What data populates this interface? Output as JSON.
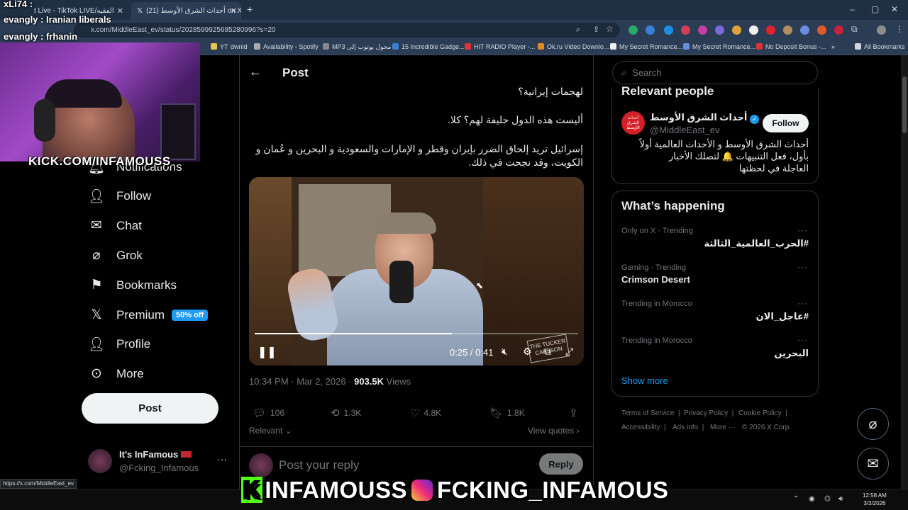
{
  "browser": {
    "tabs": [
      {
        "title": "t Live - TikTok LIVE/الفقيه"
      },
      {
        "title": "(21) أحداث الشرق الأوسط on X"
      }
    ],
    "new_tab": "+",
    "url": "x.com/MiddleEast_ev/status/2028599925685280996?s=20",
    "window_controls": [
      "–",
      "▢",
      "✕"
    ],
    "bookmarks": [
      "YT",
      "dwnld",
      "Availability - Spotify",
      "MP3 محول يوتوب إلى",
      "15 Incredible Gadge...",
      "HIT RADIO Player -...",
      "Ok.ru Video Downlo...",
      "My Secret Romance...",
      "My Secret Romance...",
      "No Deposit Bonus -..."
    ],
    "all_bookmarks": "All Bookmarks",
    "status_url": "https://x.com/MiddleEast_ev"
  },
  "stream": {
    "chat_lines": [
      "xLi74 :",
      "evangly : Iranian liberals",
      "evangly : frhanin"
    ],
    "kick_overlay": "KICK.COM/INFAMOUSS",
    "kick_letter": "K",
    "banner_kick": "INFAMOUSS",
    "banner_ig": "FCKING_INFAMOUS"
  },
  "nav": {
    "partial_item": "Notifications",
    "items": [
      {
        "label": "Follow",
        "icon": "follow-icon"
      },
      {
        "label": "Chat",
        "icon": "chat-icon"
      },
      {
        "label": "Grok",
        "icon": "grok-icon"
      },
      {
        "label": "Bookmarks",
        "icon": "bookmark-icon"
      },
      {
        "label": "Premium",
        "icon": "x-logo-icon",
        "badge": "50% off"
      },
      {
        "label": "Profile",
        "icon": "profile-icon"
      },
      {
        "label": "More",
        "icon": "more-circle-icon"
      }
    ],
    "post_button": "Post",
    "account": {
      "name": "It's InFamous",
      "handle": "@Fcking_Infamous",
      "more": "···"
    }
  },
  "post": {
    "header_title": "Post",
    "text_lines": [
      "لهجمات إيرانية؟",
      "أليست هذه الدول حليفة لهم؟ كلا.",
      "إسرائيل تريد إلحاق الضرر بإيران وقطر و الإمارات والسعودية و البحرين و عُمان و",
      "الكويت، وقد نجحت في ذلك."
    ],
    "video": {
      "time": "0:25 / 0:41",
      "progress_fraction": 0.61,
      "watermark": "THE TUCKER CARLSON"
    },
    "timestamp": "10:34 PM · Mar 2, 2026 · ",
    "views_count": "903.5K",
    "views_label": " Views",
    "stats": {
      "replies": "106",
      "reposts": "1.3K",
      "likes": "4.8K",
      "bookmarks": "1.8K"
    },
    "relevant": "Relevant ⌄",
    "view_quotes": "View quotes ›",
    "reply_placeholder": "Post your reply",
    "reply_button": "Reply"
  },
  "sidebar": {
    "search_placeholder": "Search",
    "relevant_people": {
      "title": "Relevant people",
      "name": "أحداث الشرق الأوسط",
      "handle": "@MiddleEast_ev",
      "follow": "Follow",
      "bio_lines": [
        "أحداث الشرق الأوسط و الأحداث العالمية أولاً",
        "بأول، فعل التنبيهات 🔔 لتصلك الأخبار",
        "العاجلة في لحظتها"
      ],
      "avatar_text": "أحداث الشرق الأوسط"
    },
    "whats_happening": {
      "title": "What’s happening",
      "trends": [
        {
          "meta": "Only on X · Trending",
          "name": "#الحرب_العالمية_الثالثة",
          "rtl": true
        },
        {
          "meta": "Gaming · Trending",
          "name": "Crimson Desert",
          "rtl": false
        },
        {
          "meta": "Trending in Morocco",
          "name": "#عاجل_الان",
          "rtl": true
        },
        {
          "meta": "Trending in Morocco",
          "name": "البحرين",
          "rtl": true
        }
      ],
      "show_more": "Show more"
    },
    "footer": [
      "Terms of Service",
      "Privacy Policy",
      "Cookie Policy",
      "Accessibility",
      "Ads info",
      "More ···",
      "© 2026 X Corp."
    ]
  },
  "taskbar": {
    "time": "12:58 AM",
    "date": "3/3/2026"
  },
  "colors": {
    "accent": "#1d9bf0",
    "kick_green": "#53fc18",
    "background": "#000000"
  }
}
